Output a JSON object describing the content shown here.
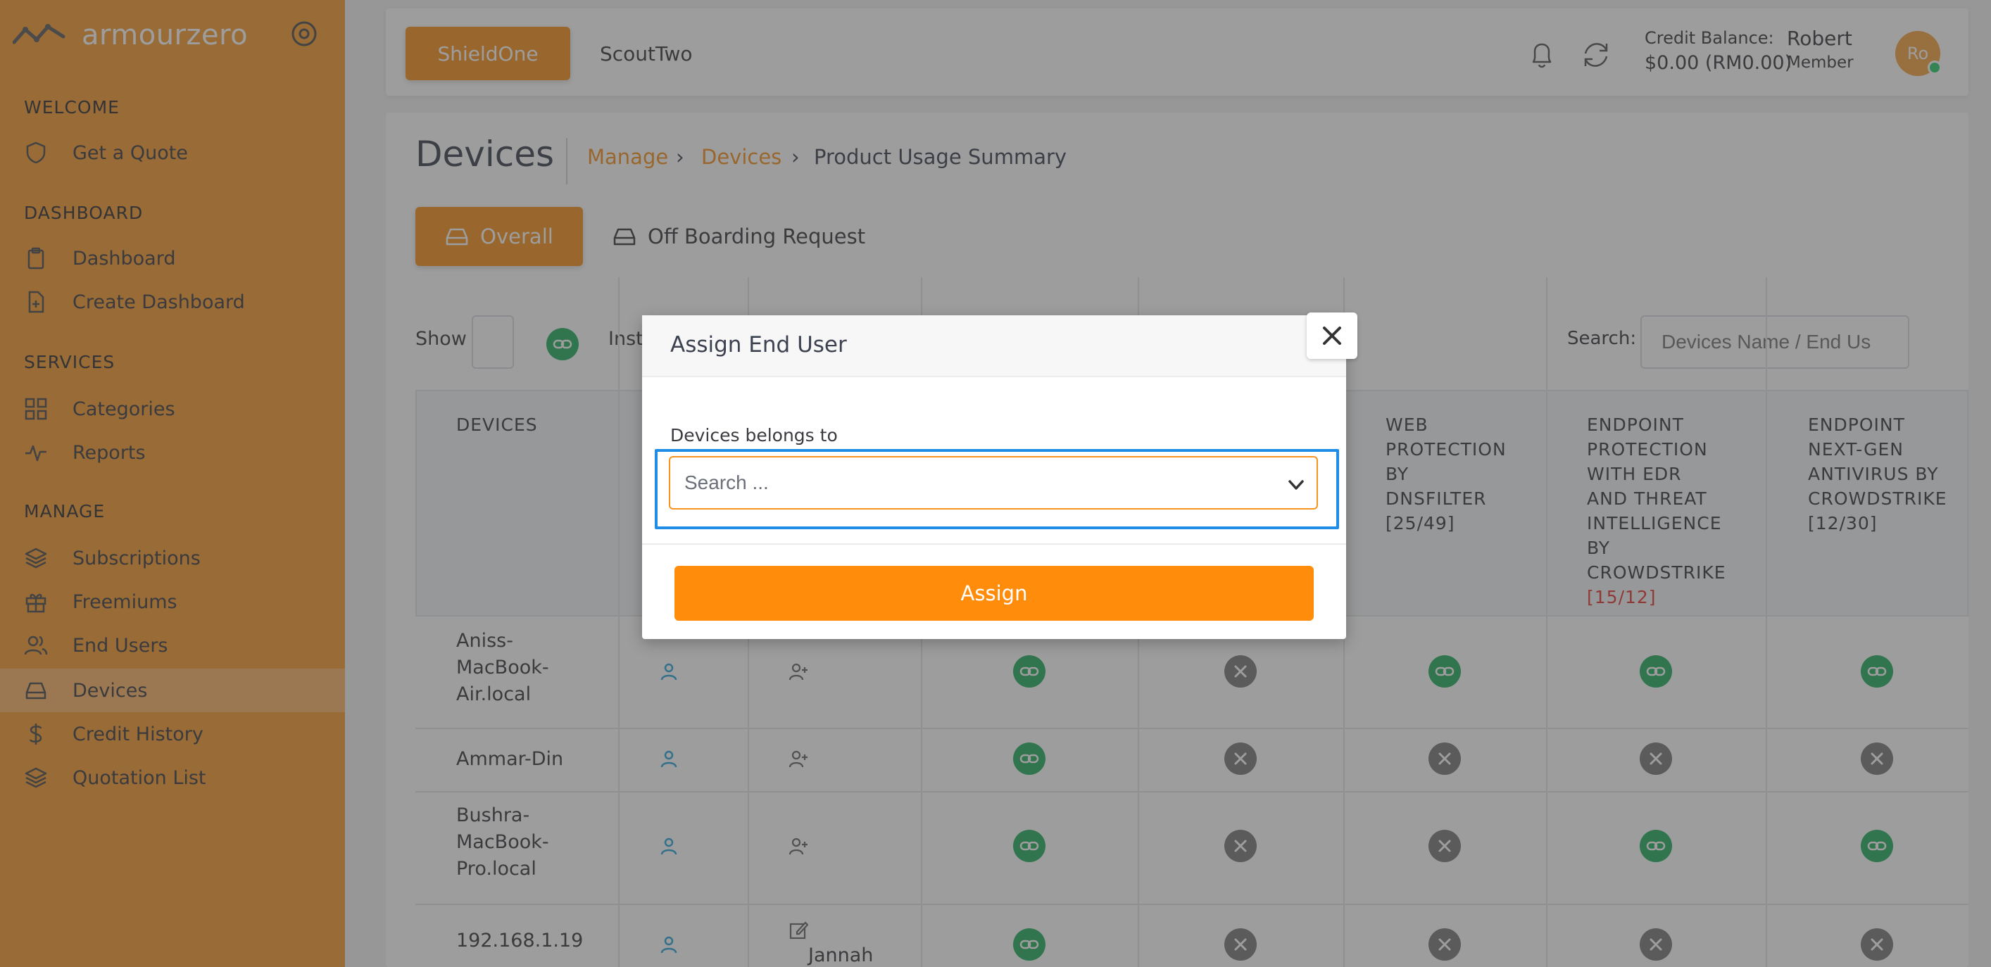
{
  "brand": {
    "name": "armourzero"
  },
  "sidebar": {
    "sections": [
      {
        "title": "WELCOME",
        "items": [
          {
            "label": "Get a Quote",
            "icon": "shield-icon"
          }
        ]
      },
      {
        "title": "DASHBOARD",
        "items": [
          {
            "label": "Dashboard",
            "icon": "clipboard-icon"
          },
          {
            "label": "Create Dashboard",
            "icon": "file-plus-icon"
          }
        ]
      },
      {
        "title": "SERVICES",
        "items": [
          {
            "label": "Categories",
            "icon": "grid-icon"
          },
          {
            "label": "Reports",
            "icon": "activity-icon"
          }
        ]
      },
      {
        "title": "MANAGE",
        "items": [
          {
            "label": "Subscriptions",
            "icon": "layers-icon"
          },
          {
            "label": "Freemiums",
            "icon": "gift-icon"
          },
          {
            "label": "End Users",
            "icon": "users-icon"
          },
          {
            "label": "Devices",
            "icon": "hard-drive-icon",
            "active": true
          },
          {
            "label": "Credit History",
            "icon": "dollar-icon"
          },
          {
            "label": "Quotation List",
            "icon": "layers-icon"
          }
        ]
      }
    ]
  },
  "topbar": {
    "tabs": [
      {
        "label": "ShieldOne",
        "active": true
      },
      {
        "label": "ScoutTwo"
      }
    ],
    "credit_label": "Credit Balance:",
    "credit_value": "$0.00 (RM0.00)",
    "user_name": "Robert",
    "user_role": "Member",
    "avatar_initials": "Ro"
  },
  "page": {
    "title": "Devices",
    "breadcrumb": [
      "Manage",
      "Devices",
      "Product Usage Summary"
    ],
    "buttons": {
      "overall": "Overall",
      "offboarding": "Off Boarding Request"
    },
    "show_label": "Show",
    "inst_text": "Inst",
    "search_label": "Search:",
    "search_placeholder": "Devices Name / End Us"
  },
  "table": {
    "headers": {
      "devices": "DEVICES",
      "web": [
        "WEB",
        "PROTECTION",
        "BY",
        "DNSFILTER",
        "[25/49]"
      ],
      "edr": [
        "ENDPOINT",
        "PROTECTION",
        "WITH EDR",
        "AND THREAT",
        "INTELLIGENCE",
        "BY",
        "CROWDSTRIKE"
      ],
      "edr_count": "[15/12]",
      "ngav": [
        "ENDPOINT",
        "NEXT-GEN",
        "ANTIVIRUS BY",
        "CROWDSTRIKE",
        "[12/30]"
      ]
    },
    "rows": [
      {
        "name": [
          "Aniss-",
          "MacBook-",
          "Air.local"
        ],
        "c1": "linked",
        "c2": "not",
        "c3": "linked",
        "c4": "linked",
        "c5": "linked"
      },
      {
        "name": [
          "Ammar-Din"
        ],
        "c1": "linked",
        "c2": "not",
        "c3": "not",
        "c4": "not",
        "c5": "not"
      },
      {
        "name": [
          "Bushra-",
          "MacBook-",
          "Pro.local"
        ],
        "c1": "linked",
        "c2": "not",
        "c3": "not",
        "c4": "linked",
        "c5": "linked"
      },
      {
        "name": [
          "192.168.1.19"
        ],
        "assignee": "Jannah",
        "c1": "linked",
        "c2": "not",
        "c3": "not",
        "c4": "not",
        "c5": "not"
      }
    ]
  },
  "modal": {
    "title": "Assign End User",
    "field_label": "Devices belongs to",
    "select_placeholder": "Search ...",
    "assign_label": "Assign"
  },
  "colors": {
    "accent": "#f7931e",
    "sidebar": "#f49a32",
    "linked": "#27ae60",
    "not_linked": "#7a7a7a",
    "focus": "#1f8ce6",
    "alert": "#e53935"
  }
}
